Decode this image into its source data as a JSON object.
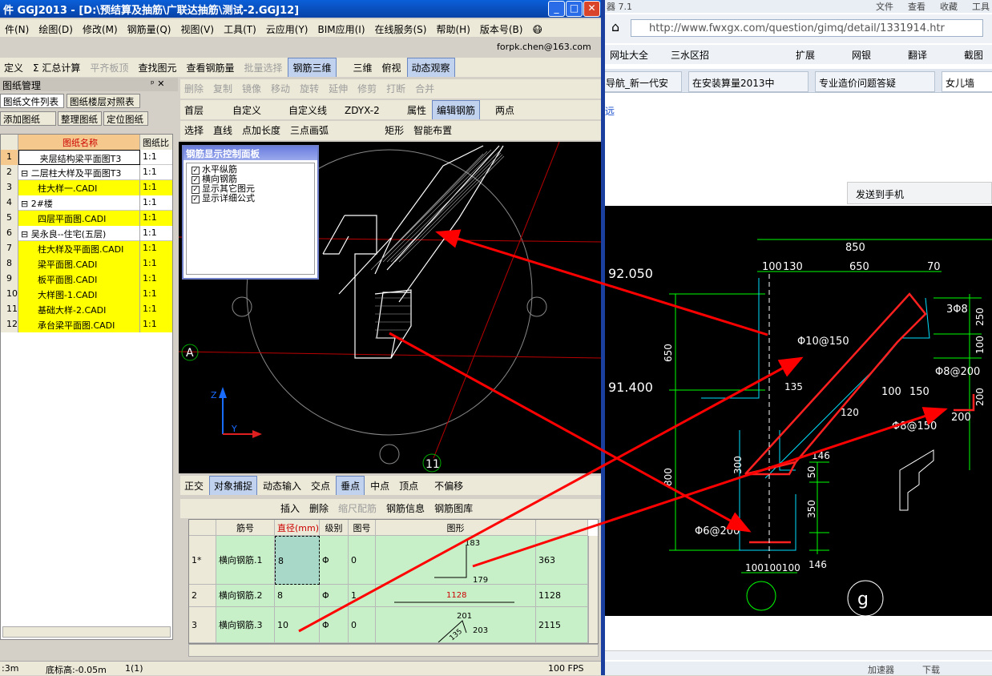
{
  "app": {
    "title": "件 GGJ2013 - [D:\\预结算及抽筋\\广联达抽筋\\测试-2.GGJ12]",
    "email": "forpk.chen@163.com"
  },
  "menu": [
    "件(N)",
    "绘图(D)",
    "修改(M)",
    "钢筋量(Q)",
    "视图(V)",
    "工具(T)",
    "云应用(Y)",
    "BIM应用(I)",
    "在线服务(S)",
    "帮助(H)",
    "版本号(B)"
  ],
  "toolbar1": [
    "定义",
    "Σ 汇总计算",
    "平齐板顶",
    "查找图元",
    "查看钢筋量",
    "批量选择",
    "钢筋三维",
    "三维",
    "俯视",
    "动态观察"
  ],
  "toolbar2": [
    "删除",
    "复制",
    "镜像",
    "移动",
    "旋转",
    "延伸",
    "修剪",
    "打断",
    "合并"
  ],
  "toolbar3": {
    "floor": "首层",
    "type": "自定义",
    "line": "自定义线",
    "code": "ZDYX-2",
    "prop": "属性",
    "edit": "编辑钢筋",
    "twopoint": "两点"
  },
  "toolbar4": [
    "选择",
    "直线",
    "点加长度",
    "三点画弧",
    "矩形",
    "智能布置"
  ],
  "drawingPanel": {
    "title": "图纸管理",
    "tabs": [
      "图纸文件列表",
      "图纸楼层对照表"
    ],
    "buttons": [
      "添加图纸",
      "整理图纸",
      "定位图纸"
    ],
    "headers": [
      "图纸名称",
      "图纸比"
    ],
    "rows": [
      {
        "n": "1",
        "name": "夹层结构梁平面图T3",
        "scale": "1:1",
        "y": false
      },
      {
        "n": "2",
        "name": "二层柱大样及平面图T3",
        "scale": "1:1",
        "y": false
      },
      {
        "n": "3",
        "name": "柱大样一.CADI",
        "scale": "1:1",
        "y": true
      },
      {
        "n": "4",
        "name": "2#楼",
        "scale": "1:1",
        "y": false
      },
      {
        "n": "5",
        "name": "四层平面图.CADI",
        "scale": "1:1",
        "y": true
      },
      {
        "n": "6",
        "name": "吴永良--住宅(五层)",
        "scale": "1:1",
        "y": false
      },
      {
        "n": "7",
        "name": "柱大样及平面图.CADI",
        "scale": "1:1",
        "y": true
      },
      {
        "n": "8",
        "name": "梁平面图.CADI",
        "scale": "1:1",
        "y": true
      },
      {
        "n": "9",
        "name": "板平面图.CADI",
        "scale": "1:1",
        "y": true
      },
      {
        "n": "10",
        "name": "大样图-1.CADI",
        "scale": "1:1",
        "y": true
      },
      {
        "n": "11",
        "name": "基础大样-2.CADI",
        "scale": "1:1",
        "y": true
      },
      {
        "n": "12",
        "name": "承台梁平面图.CADI",
        "scale": "1:1",
        "y": true
      }
    ]
  },
  "ctrlPanel": {
    "title": "钢筋显示控制面板",
    "items": [
      "水平纵筋",
      "横向钢筋",
      "显示其它图元",
      "显示详细公式"
    ]
  },
  "cadLabels": {
    "axisA": "A",
    "axis11": "11",
    "z": "Z",
    "y": "Y"
  },
  "snapbar": [
    "正交",
    "对象捕捉",
    "动态输入",
    "交点",
    "垂点",
    "中点",
    "顶点",
    "不偏移"
  ],
  "gridToolbar": [
    "插入",
    "删除",
    "缩尺配筋",
    "钢筋信息",
    "钢筋图库"
  ],
  "grid": {
    "headers": [
      "筋号",
      "直径(mm)",
      "级别",
      "图号",
      "图形",
      ""
    ],
    "rows": [
      {
        "n": "1*",
        "name": "横向钢筋.1",
        "dia": "8",
        "lvl": "Φ",
        "fig": "0",
        "shape": [
          "183",
          "179"
        ],
        "len": "363"
      },
      {
        "n": "2",
        "name": "横向钢筋.2",
        "dia": "8",
        "lvl": "Φ",
        "fig": "1",
        "shape": [
          "1128"
        ],
        "len": "1128"
      },
      {
        "n": "3",
        "name": "横向钢筋.3",
        "dia": "10",
        "lvl": "Φ",
        "fig": "0",
        "shape": [
          "201",
          "203",
          "135"
        ],
        "len": "2115"
      }
    ]
  },
  "status": {
    "a": ":3m",
    "b": "底标高:-0.05m",
    "c": "1(1)",
    "fps": "100 FPS"
  },
  "browser": {
    "top": [
      "器 7.1",
      "文件",
      "查看",
      "收藏",
      "工具"
    ],
    "url": "http://www.fwxgx.com/question/gimq/detail/1331914.htr",
    "bookmarks": [
      "网址大全",
      "三水区招",
      "扩展",
      "网银",
      "翻译",
      "截图"
    ],
    "tabs": [
      "导航_新一代安",
      "在安装算量2013中",
      "专业造价问题答疑",
      "女儿墙"
    ],
    "side": "远",
    "send": "发送到手机",
    "bottom": [
      "加速器",
      "下载"
    ]
  },
  "cad": {
    "elev1": "92.050",
    "elev2": "91.400",
    "d850": "850",
    "d100": "100",
    "d130": "130",
    "d650": "650",
    "d70": "70",
    "v650": "650",
    "v800": "800",
    "v300": "300",
    "v250": "250",
    "v100": "100",
    "v50": "50",
    "v350": "350",
    "b1": "3Φ8",
    "b2": "Φ10@150",
    "b3": "Φ8@200",
    "b4": "Φ8@150",
    "b5": "Φ6@200",
    "a135": "135",
    "a120": "120",
    "h100": "100",
    "h150": "150",
    "d146": "146",
    "d200": "200",
    "d200b": "200",
    "bot": "100100100",
    "s1": "100",
    "s2": "100",
    "s3": "120",
    "s4": "150",
    "s5": "146"
  },
  "colors": {
    "arrow": "#ff0000",
    "green": "#00ff00",
    "rebar": "#ff2020",
    "yellow": "#ffff00"
  }
}
